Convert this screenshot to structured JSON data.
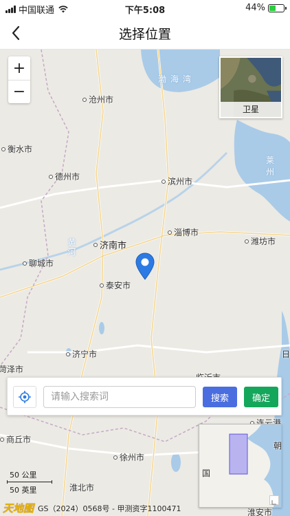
{
  "status_bar": {
    "carrier": "中国联通",
    "time": "下午5:08",
    "battery": "44%",
    "battery_level": 0.44
  },
  "nav": {
    "title": "选择位置",
    "back_icon": "chevron-left-icon"
  },
  "map": {
    "zoom_in": "+",
    "zoom_out": "−",
    "layer_switch_label": "卫星",
    "water_labels": [
      "渤海湾",
      "莱州",
      "黄河"
    ],
    "cities": [
      "沧州市",
      "衡水市",
      "德州市",
      "滨州市",
      "淄博市",
      "潍坊市",
      "济南市",
      "聊城市",
      "泰安市",
      "济宁市",
      "菏泽市",
      "日",
      "商丘市",
      "徐州市",
      "淮北市",
      "连云港",
      "淮安市",
      "朝",
      "临沂市"
    ],
    "overview_label": "国",
    "scale_km": "50 公里",
    "scale_mi": "50 英里",
    "attribution_logo": "天地图",
    "attribution": "GS（2024）0568号 - 甲测资字1100471"
  },
  "search": {
    "placeholder": "请输入搜索词",
    "value": "",
    "search_button": "搜索",
    "confirm_button": "确定"
  },
  "colors": {
    "search_button": "#4a6ee0",
    "confirm_button": "#14a75b",
    "marker": "#2c7be5",
    "water": "#a9cbe8"
  }
}
